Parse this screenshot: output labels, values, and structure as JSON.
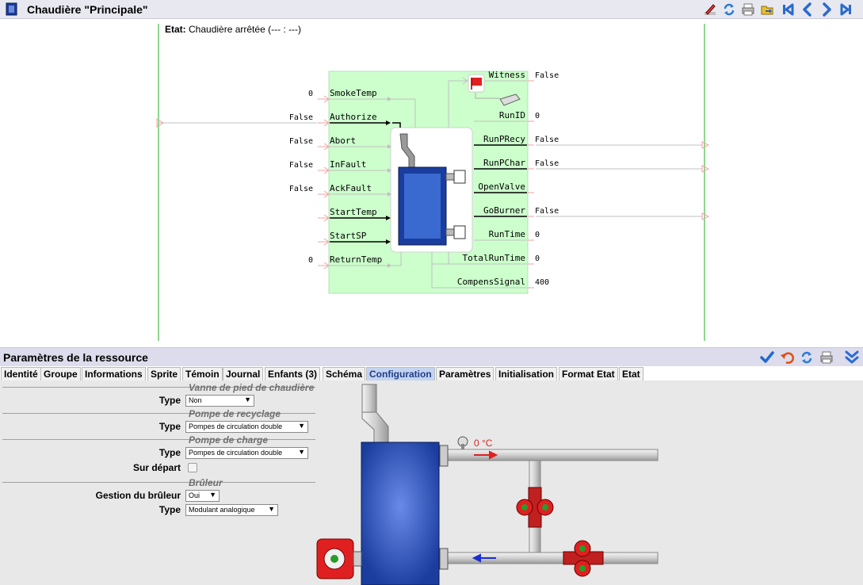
{
  "window": {
    "title": "Chaudière \"Principale\""
  },
  "toolbar_icons": [
    "edit-icon",
    "refresh-icon",
    "print-icon",
    "export-icon",
    "first-icon",
    "previous-icon",
    "next-icon",
    "last-icon"
  ],
  "status": {
    "label": "Etat:",
    "value": "Chaudière arrêtée (--- : ---)"
  },
  "block": {
    "inputs": [
      {
        "name": "SmokeTemp",
        "value": "0"
      },
      {
        "name": "Authorize",
        "value": "False"
      },
      {
        "name": "Abort",
        "value": "False"
      },
      {
        "name": "InFault",
        "value": "False"
      },
      {
        "name": "AckFault",
        "value": "False"
      },
      {
        "name": "StartTemp",
        "value": ""
      },
      {
        "name": "StartSP",
        "value": ""
      },
      {
        "name": "ReturnTemp",
        "value": "0"
      }
    ],
    "outputs": [
      {
        "name": "Witness",
        "value": "False"
      },
      {
        "name": "RunID",
        "value": "0"
      },
      {
        "name": "RunPRecy",
        "value": "False"
      },
      {
        "name": "RunPChar",
        "value": "False"
      },
      {
        "name": "OpenValve",
        "value": ""
      },
      {
        "name": "GoBurner",
        "value": "False"
      },
      {
        "name": "RunTime",
        "value": "0"
      },
      {
        "name": "TotalRunTime",
        "value": "0"
      },
      {
        "name": "CompensSignal",
        "value": "400"
      }
    ]
  },
  "panel": {
    "title": "Paramètres de la ressource",
    "tabs": [
      {
        "label": "Identité",
        "active": false
      },
      {
        "label": "Groupe",
        "active": false
      },
      {
        "label": "Informations",
        "active": false
      },
      {
        "label": "Sprite",
        "active": false
      },
      {
        "label": "Témoin",
        "active": false
      },
      {
        "label": "Journal",
        "active": false
      },
      {
        "label": "Enfants (3)",
        "active": false
      },
      {
        "label": "Schéma",
        "active": false
      },
      {
        "label": "Configuration",
        "active": true
      },
      {
        "label": "Paramètres",
        "active": false
      },
      {
        "label": "Initialisation",
        "active": false
      },
      {
        "label": "Format Etat",
        "active": false
      },
      {
        "label": "Etat",
        "active": false
      }
    ],
    "header_icons": [
      "validate-icon",
      "undo-icon",
      "refresh-icon",
      "print-icon",
      "collapse-icon"
    ]
  },
  "config": {
    "sections": [
      {
        "title": "Vanne de pied de chaudière",
        "fields": [
          {
            "label": "Type",
            "value": "Non"
          }
        ]
      },
      {
        "title": "Pompe de recyclage",
        "fields": [
          {
            "label": "Type",
            "value": "Pompes de circulation double"
          }
        ]
      },
      {
        "title": "Pompe de charge",
        "fields": [
          {
            "label": "Type",
            "value": "Pompes de circulation double"
          },
          {
            "label": "Sur départ",
            "checked": false
          }
        ]
      },
      {
        "title": "Brûleur",
        "fields": [
          {
            "label": "Gestion du brûleur",
            "value": "Oui"
          },
          {
            "label": "Type",
            "value": "Modulant analogique"
          }
        ]
      }
    ],
    "schema_temperature": "0 °C"
  },
  "colors": {
    "accent": "#1f3c88",
    "block_bg": "#ccffcc",
    "boiler_blue": "#1a3d9e",
    "arrow_red": "#e02020",
    "arrow_blue": "#1a2ed0"
  }
}
